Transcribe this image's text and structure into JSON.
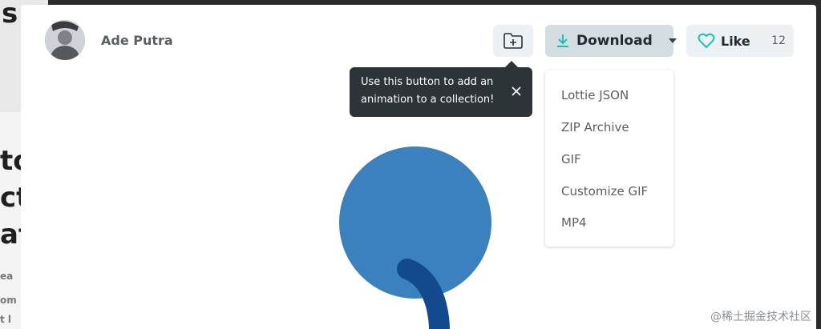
{
  "author": {
    "name": "Ade Putra"
  },
  "toolbar": {
    "download_label": "Download",
    "like_label": "Like",
    "like_count": "12"
  },
  "tooltip": {
    "text": "Use this button to add an animation to a collection!"
  },
  "download_menu": {
    "items": [
      "Lottie JSON",
      "ZIP Archive",
      "GIF",
      "Customize GIF",
      "MP4"
    ]
  },
  "background_page": {
    "heading_letter": "s",
    "heading_lines": [
      "to",
      "ct",
      "at"
    ],
    "snippets": [
      "ea",
      "om",
      "t l"
    ]
  },
  "icons": {
    "collection": "folder-plus-icon",
    "download": "download-icon",
    "caret": "chevron-down-icon",
    "like": "heart-icon",
    "close": "close-icon"
  },
  "colors": {
    "accent_teal": "#17c3b2",
    "download_bg": "#d3dde2",
    "tooltip_bg": "#2d3438",
    "circle_blue": "#3a81bd",
    "stroke_navy": "#134a8e"
  },
  "watermark": "@稀土掘金技术社区"
}
